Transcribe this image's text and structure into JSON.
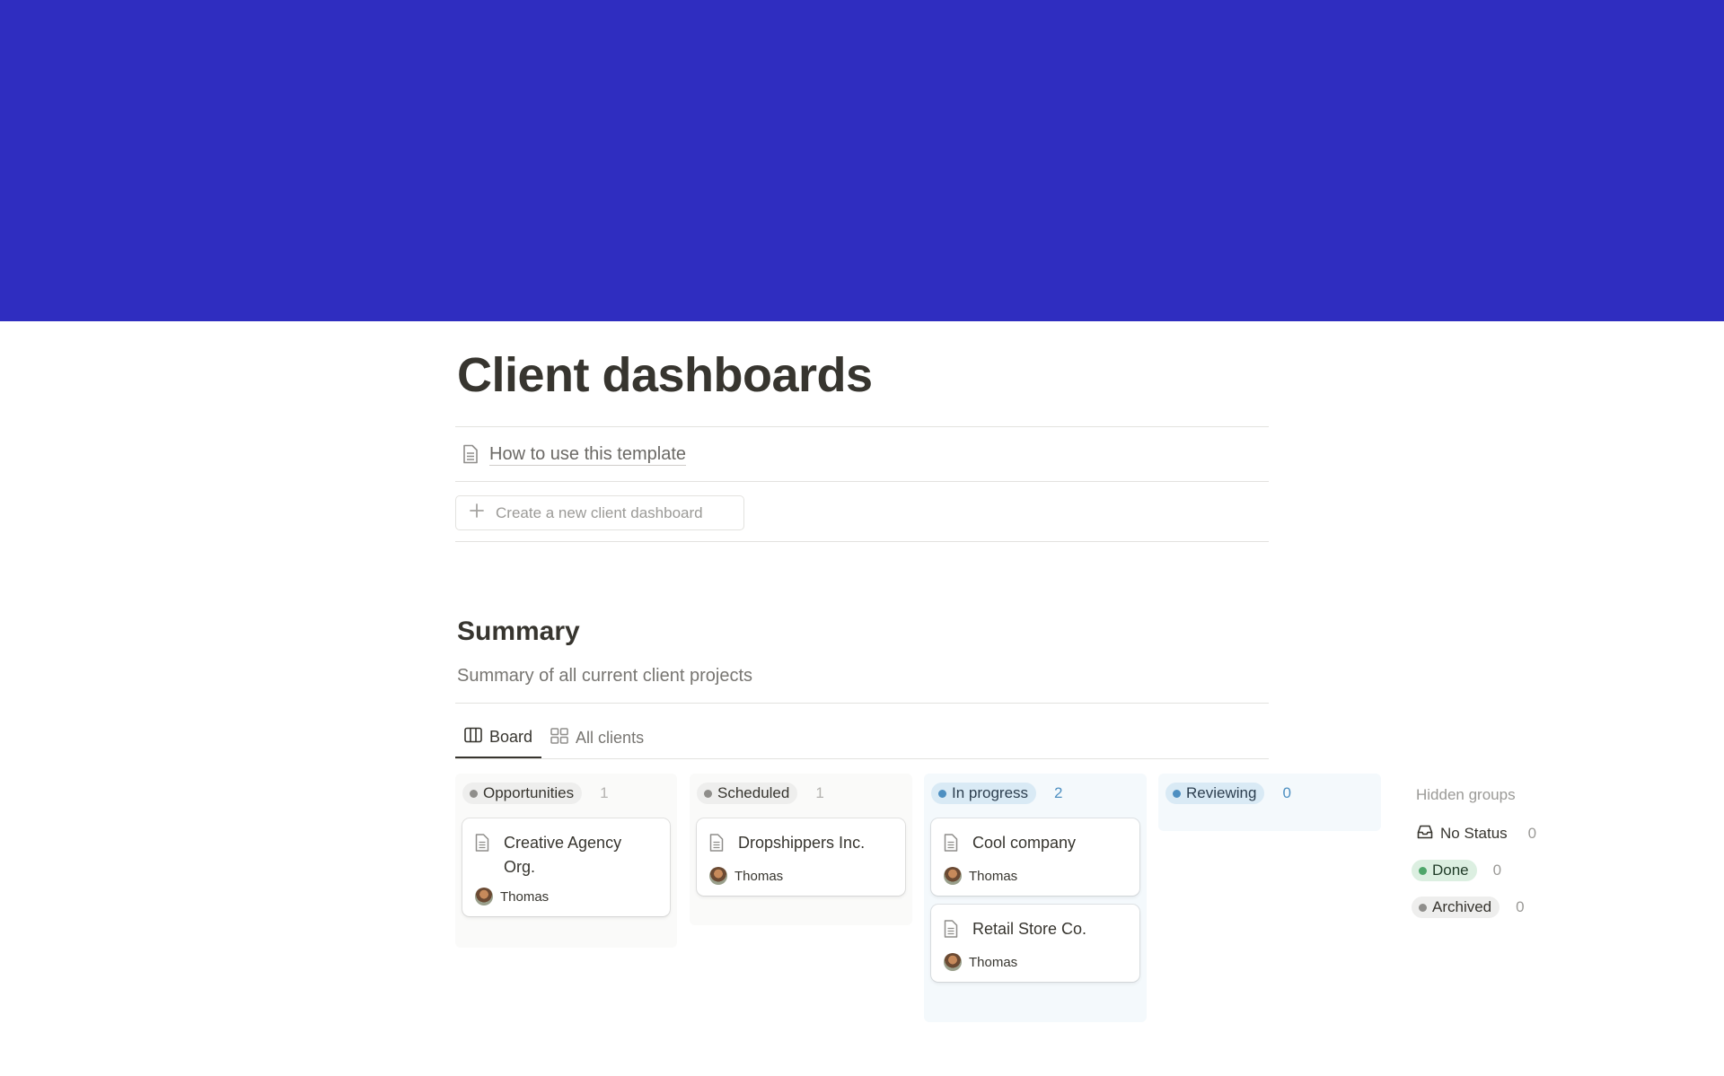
{
  "cover": {
    "color": "#2f2dc0"
  },
  "page": {
    "title": "Client dashboards"
  },
  "template_link": {
    "label": "How to use this template",
    "icon": "page-icon"
  },
  "create_button": {
    "label": "Create a new client dashboard",
    "icon": "plus-icon"
  },
  "summary": {
    "title": "Summary",
    "description": "Summary of all current client projects"
  },
  "tabs": [
    {
      "label": "Board",
      "icon": "board-icon",
      "active": true
    },
    {
      "label": "All clients",
      "icon": "gallery-icon",
      "active": false
    }
  ],
  "columns": [
    {
      "label": "Opportunities",
      "count": "1",
      "colors": {
        "bg": "#fafaf9",
        "pill": "#eeeeed",
        "dot": "#8f8e8b",
        "count": "#b4b3b0"
      },
      "cards": [
        {
          "title": "Creative Agency Org.",
          "owner": "Thomas"
        }
      ]
    },
    {
      "label": "Scheduled",
      "count": "1",
      "colors": {
        "bg": "#fafaf9",
        "pill": "#eeeeed",
        "dot": "#8f8e8b",
        "count": "#b4b3b0"
      },
      "cards": [
        {
          "title": "Dropshippers Inc.",
          "owner": "Thomas"
        }
      ]
    },
    {
      "label": "In progress",
      "count": "2",
      "colors": {
        "bg": "#f4f9fc",
        "pill": "#d9eaf5",
        "dot": "#4d8fc1",
        "count": "#4d8fc1"
      },
      "cards": [
        {
          "title": "Cool company",
          "owner": "Thomas"
        },
        {
          "title": "Retail Store Co.",
          "owner": "Thomas"
        }
      ]
    },
    {
      "label": "Reviewing",
      "count": "0",
      "colors": {
        "bg": "#f4f9fc",
        "pill": "#d9eaf5",
        "dot": "#4d8fc1",
        "count": "#4d8fc1"
      },
      "cards": []
    }
  ],
  "hidden_groups": {
    "title": "Hidden groups",
    "groups": [
      {
        "label": "No Status",
        "count": "0",
        "icon": "inbox-icon"
      },
      {
        "label": "Done",
        "count": "0",
        "pill": "#dcefe1",
        "dot": "#4ea66a"
      },
      {
        "label": "Archived",
        "count": "0",
        "pill": "#eeeeed",
        "dot": "#8f8e8b"
      }
    ]
  }
}
